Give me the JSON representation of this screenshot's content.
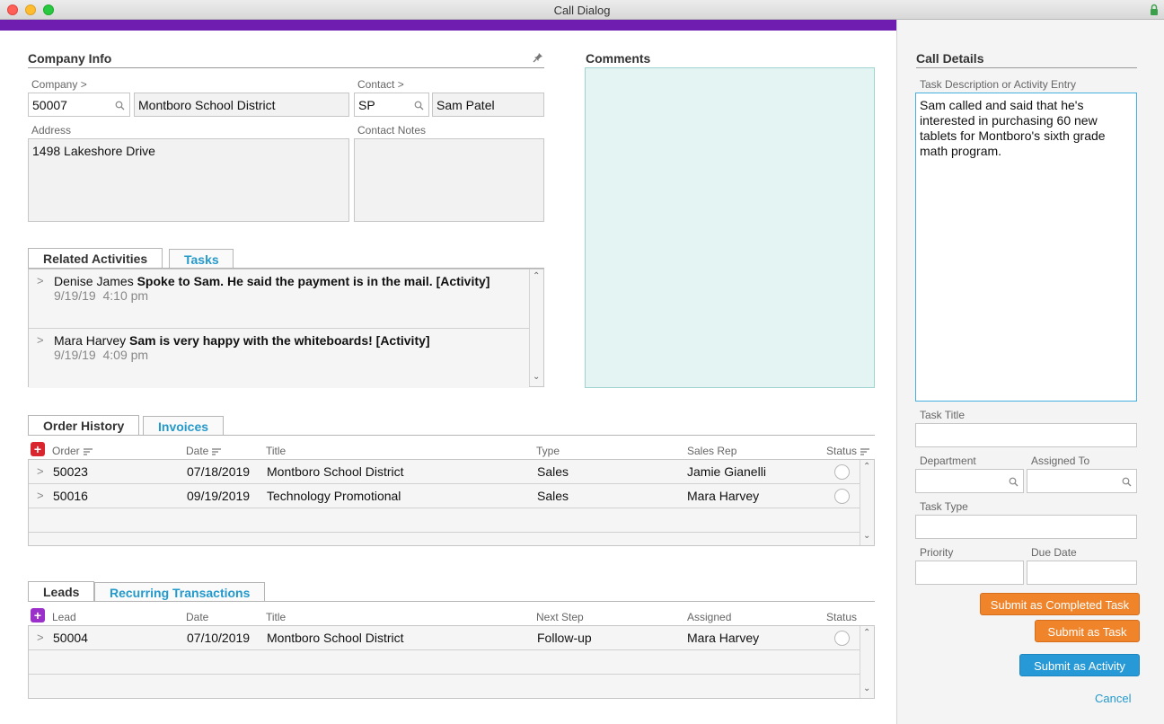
{
  "window": {
    "title": "Call Dialog"
  },
  "company_info": {
    "title": "Company Info",
    "company_label": "Company >",
    "company_id": "50007",
    "company_name": "Montboro School District",
    "contact_label": "Contact >",
    "contact_code": "SP",
    "contact_name": "Sam Patel",
    "address_label": "Address",
    "address": "1498 Lakeshore Drive",
    "contact_notes_label": "Contact Notes",
    "contact_notes": ""
  },
  "comments": {
    "title": "Comments",
    "value": ""
  },
  "related": {
    "tabs": [
      "Related Activities",
      "Tasks"
    ],
    "items": [
      {
        "name": "Denise James",
        "text": "Spoke to Sam. He said the payment is in the mail. [Activity]",
        "date": "9/19/19",
        "time": "4:10 pm"
      },
      {
        "name": "Mara Harvey",
        "text": "Sam is very happy with the whiteboards! [Activity]",
        "date": "9/19/19",
        "time": "4:09 pm"
      }
    ]
  },
  "orders": {
    "tabs": [
      "Order History",
      "Invoices"
    ],
    "headers": [
      "Order",
      "Date",
      "Title",
      "Type",
      "Sales Rep",
      "Status"
    ],
    "rows": [
      {
        "order": "50023",
        "date": "07/18/2019",
        "title": "Montboro School District",
        "type": "Sales",
        "rep": "Jamie Gianelli"
      },
      {
        "order": "50016",
        "date": "09/19/2019",
        "title": "Technology Promotional",
        "type": "Sales",
        "rep": "Mara Harvey"
      }
    ]
  },
  "leads": {
    "tabs": [
      "Leads",
      "Recurring Transactions"
    ],
    "headers": [
      "Lead",
      "Date",
      "Title",
      "Next Step",
      "Assigned",
      "Status"
    ],
    "rows": [
      {
        "lead": "50004",
        "date": "07/10/2019",
        "title": "Montboro School District",
        "next": "Follow-up",
        "assigned": "Mara Harvey"
      }
    ]
  },
  "call_details": {
    "title": "Call Details",
    "task_desc_label": "Task Description or Activity Entry",
    "task_desc": "Sam called and said that he's interested in purchasing 60 new tablets for Montboro's sixth grade math program.",
    "task_title_label": "Task Title",
    "department_label": "Department",
    "assigned_to_label": "Assigned To",
    "task_type_label": "Task Type",
    "priority_label": "Priority",
    "due_date_label": "Due Date",
    "btn_completed": "Submit as Completed Task",
    "btn_task": "Submit as Task",
    "btn_activity": "Submit as Activity",
    "cancel": "Cancel"
  },
  "colors": {
    "accent_purple": "#6f1db0",
    "orange": "#f0842b",
    "blue": "#2699d6",
    "link": "#2499cc",
    "comments_bg": "#e3f4f2",
    "add_red": "#d9262e",
    "add_purple": "#9b2fc9"
  }
}
